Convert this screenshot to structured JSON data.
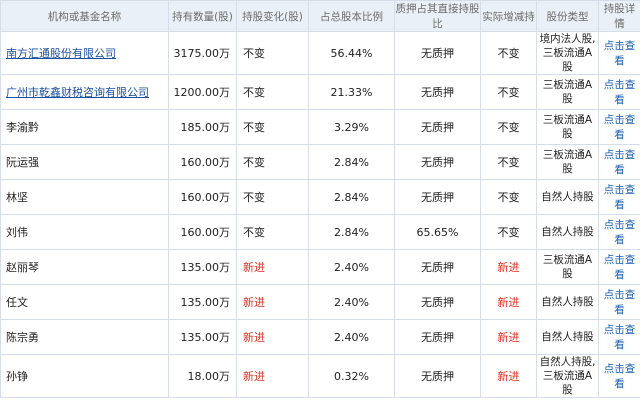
{
  "colors": {
    "link": "#1a5fb4",
    "new": "#e0301e",
    "header_bg": "#eaf0f7"
  },
  "headers": [
    "机构或基金名称",
    "持有数量(股)",
    "持股变化(股)",
    "占总股本比例",
    "质押占其直接持股比",
    "实际增减持",
    "股份类型",
    "持股详情"
  ],
  "rows": [
    {
      "name": "南方汇通股份有限公司",
      "qty": "3175.00万",
      "change": "不变",
      "ratio": "56.44%",
      "pledge": "无质押",
      "actual": "不变",
      "type": "境内法人股,三板流通A股",
      "detail": "点击查看",
      "is_new": false,
      "is_link": true
    },
    {
      "name": "广州市乾鑫财税咨询有限公司",
      "qty": "1200.00万",
      "change": "不变",
      "ratio": "21.33%",
      "pledge": "无质押",
      "actual": "不变",
      "type": "三板流通A股",
      "detail": "点击查看",
      "is_new": false,
      "is_link": true
    },
    {
      "name": "李渝黔",
      "qty": "185.00万",
      "change": "不变",
      "ratio": "3.29%",
      "pledge": "无质押",
      "actual": "不变",
      "type": "三板流通A股",
      "detail": "点击查看",
      "is_new": false,
      "is_link": false
    },
    {
      "name": "阮运强",
      "qty": "160.00万",
      "change": "不变",
      "ratio": "2.84%",
      "pledge": "无质押",
      "actual": "不变",
      "type": "三板流通A股",
      "detail": "点击查看",
      "is_new": false,
      "is_link": false
    },
    {
      "name": "林坚",
      "qty": "160.00万",
      "change": "不变",
      "ratio": "2.84%",
      "pledge": "无质押",
      "actual": "不变",
      "type": "自然人持股",
      "detail": "点击查看",
      "is_new": false,
      "is_link": false
    },
    {
      "name": "刘伟",
      "qty": "160.00万",
      "change": "不变",
      "ratio": "2.84%",
      "pledge": "65.65%",
      "actual": "不变",
      "type": "自然人持股",
      "detail": "点击查看",
      "is_new": false,
      "is_link": false
    },
    {
      "name": "赵丽琴",
      "qty": "135.00万",
      "change": "新进",
      "ratio": "2.40%",
      "pledge": "无质押",
      "actual": "新进",
      "type": "三板流通A股",
      "detail": "点击查看",
      "is_new": true,
      "is_link": false
    },
    {
      "name": "任文",
      "qty": "135.00万",
      "change": "新进",
      "ratio": "2.40%",
      "pledge": "无质押",
      "actual": "新进",
      "type": "自然人持股",
      "detail": "点击查看",
      "is_new": true,
      "is_link": false
    },
    {
      "name": "陈宗勇",
      "qty": "135.00万",
      "change": "新进",
      "ratio": "2.40%",
      "pledge": "无质押",
      "actual": "新进",
      "type": "自然人持股",
      "detail": "点击查看",
      "is_new": true,
      "is_link": false
    },
    {
      "name": "孙铮",
      "qty": "18.00万",
      "change": "新进",
      "ratio": "0.32%",
      "pledge": "无质押",
      "actual": "新进",
      "type": "自然人持股,三板流通A股",
      "detail": "点击查看",
      "is_new": true,
      "is_link": false
    }
  ]
}
